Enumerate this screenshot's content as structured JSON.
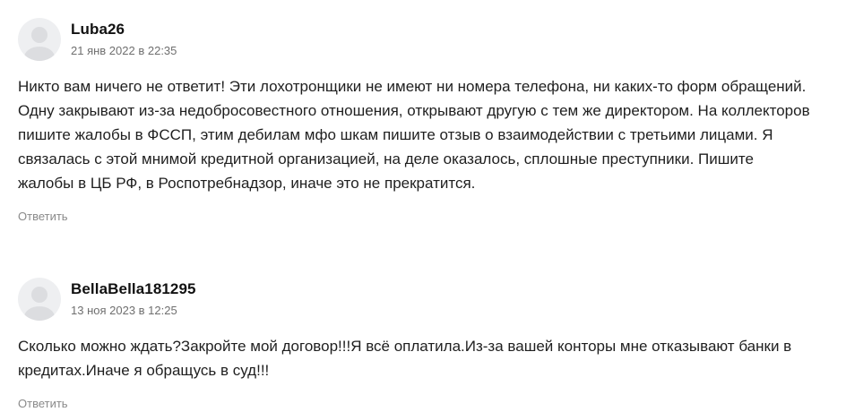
{
  "comments": [
    {
      "author": "Luba26",
      "date": "21 янв 2022 в 22:35",
      "text": "Никто вам ничего не ответит! Эти лохотронщики не имеют ни номера телефона, ни каких-то форм обращений. Одну закрывают из-за недобросовестного отношения, открывают другую с тем же директором. На коллекторов пишите жалобы в ФССП, этим дебилам мфо шкам пишите отзыв о взаимодействии с третьими лицами. Я связалась с этой мнимой кредитной организацией, на деле оказалось, сплошные преступники. Пишите жалобы в ЦБ РФ, в Роспотребнадзор, иначе это не прекратится.",
      "reply_label": "Ответить",
      "avatar_icon": "user-avatar-placeholder-icon"
    },
    {
      "author": "BellaBella181295",
      "date": "13 ноя 2023 в 12:25",
      "text": "Сколько можно ждать?Закройте мой договор!!!Я всё оплатила.Из-за вашей конторы мне отказывают банки в кредитах.Иначе я обращусь в суд!!!",
      "reply_label": "Ответить",
      "avatar_icon": "user-avatar-placeholder-icon"
    }
  ],
  "colors": {
    "avatar_bg": "#eeeff1",
    "avatar_figure": "#dcdde0",
    "author": "#111111",
    "date": "#6f6f6f",
    "text": "#1f1f1f",
    "reply": "#8a8a8a"
  }
}
